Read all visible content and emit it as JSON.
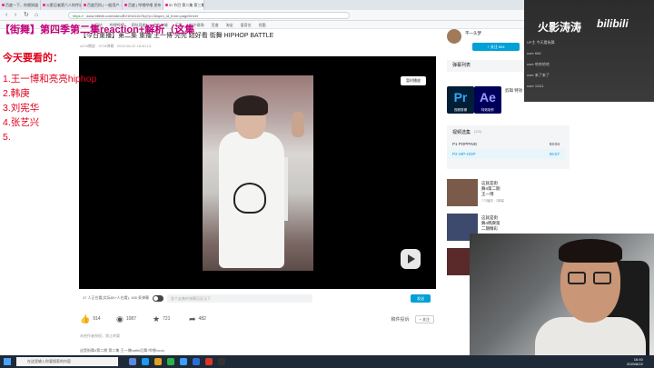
{
  "browser": {
    "tabs": [
      "百度一下，你就知道",
      "火影忍者第六人的传说 B站",
      "百度百科 | 一般用户...",
      "百度 | 哔哩哔哩 发布",
      "ID 节目 第二集 第三集"
    ],
    "url_secure": "https://",
    "url": "www.bilibili.com/video/BV1Kt411b7bq?p=2&spm_id_from=pageDriver",
    "bookmarks": [
      "Pc网站",
      "哔哩哔哩",
      "网址导航",
      "京东商城",
      "天猫",
      "苏宁易购",
      "百度",
      "淘宝",
      "爱奇艺",
      "优酷"
    ]
  },
  "video": {
    "title": "【今日重播】第二集 重播 王一博 亮亮 超好看 街舞 HIPHOP BATTLE",
    "meta": "4478播放 · 4718弹幕 · 2020-08-22 18:40:13",
    "sync_button": "暂时播放",
    "danmaku_status": "47 人正在看(实际80+人在看), 465 条弹幕",
    "danmaku_placeholder": "发个友善的弹幕见证当下",
    "danmaku_send": "发送",
    "likes": "914",
    "coins": "1087",
    "favorites": "721",
    "shares": "482",
    "report": "稿件投诉",
    "follow_note": "+ 关注",
    "note1": "未经作者授权，禁止转载",
    "note2": "这是街舞4第二期 第二集 王一博battle后舞 哔哩focus"
  },
  "overlay": {
    "title": "【街舞】第四季第二集reaction+解析（这集",
    "heading": "今天要看的：",
    "items": [
      "1.王一博和亮亮hiphop",
      "2.韩庚",
      "3.刘宪华",
      "4.张艺兴",
      "5."
    ]
  },
  "sidebar": {
    "uploader": "不一头梦",
    "follow": "+ 关注 854",
    "danmaku_list": "弹幕列表",
    "ad_pr": "Pr",
    "ad_ae": "Ae",
    "ad_pr_sub": "视频剪辑",
    "ad_ae_sub": "特效制作",
    "ad_text": "剪辑 特效 一次学会",
    "series_title": "视频选集",
    "series_count": "(2/2)",
    "series": [
      {
        "label": "P1  POPPING",
        "time": "03:04"
      },
      {
        "label": "P2  HIP-HOP",
        "time": "06:57"
      }
    ],
    "recs": [
      {
        "title": "这就是街舞4第二期王一博",
        "meta": "773播放 · 2弹幕"
      },
      {
        "title": "这就是街舞4韩庚第二期精彩",
        "meta": "1.2万播放"
      },
      {
        "title": "街舞",
        "meta": "806播放"
      }
    ]
  },
  "live": {
    "brand": "火影涛涛",
    "logo": "bilibili",
    "lines": [
      "UP主 今天看街舞",
      "user 666",
      "user 哈哈哈哈",
      "user 来了来了",
      "user 11111"
    ]
  },
  "taskbar": {
    "search": "在这里输入你要搜索的内容",
    "time": "16:40",
    "date": "2020/8/22"
  }
}
